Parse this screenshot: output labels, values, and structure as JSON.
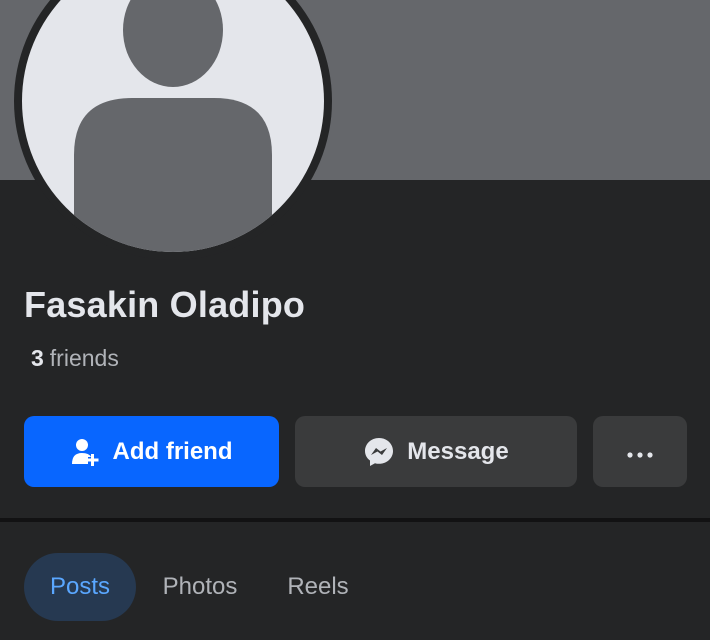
{
  "profile": {
    "name": "Fasakin Oladipo",
    "friends_count": "3",
    "friends_label": "friends"
  },
  "actions": {
    "add_friend_label": "Add friend",
    "message_label": "Message",
    "more_label": "More options"
  },
  "tabs": [
    {
      "label": "Posts",
      "selected": true
    },
    {
      "label": "Photos",
      "selected": false
    },
    {
      "label": "Reels",
      "selected": false
    }
  ],
  "icons": {
    "add_friend": "add-friend-icon",
    "message": "messenger-icon",
    "more": "more-dots-icon",
    "avatar": "default-avatar-icon"
  },
  "colors": {
    "background": "#242526",
    "cover": "#65676b",
    "primary": "#0866ff",
    "secondary_button": "#3a3b3c",
    "text_primary": "#e4e6eb",
    "text_secondary": "#b0b3b8",
    "tab_selected_bg": "#263951",
    "tab_selected_text": "#5aa7ff"
  }
}
